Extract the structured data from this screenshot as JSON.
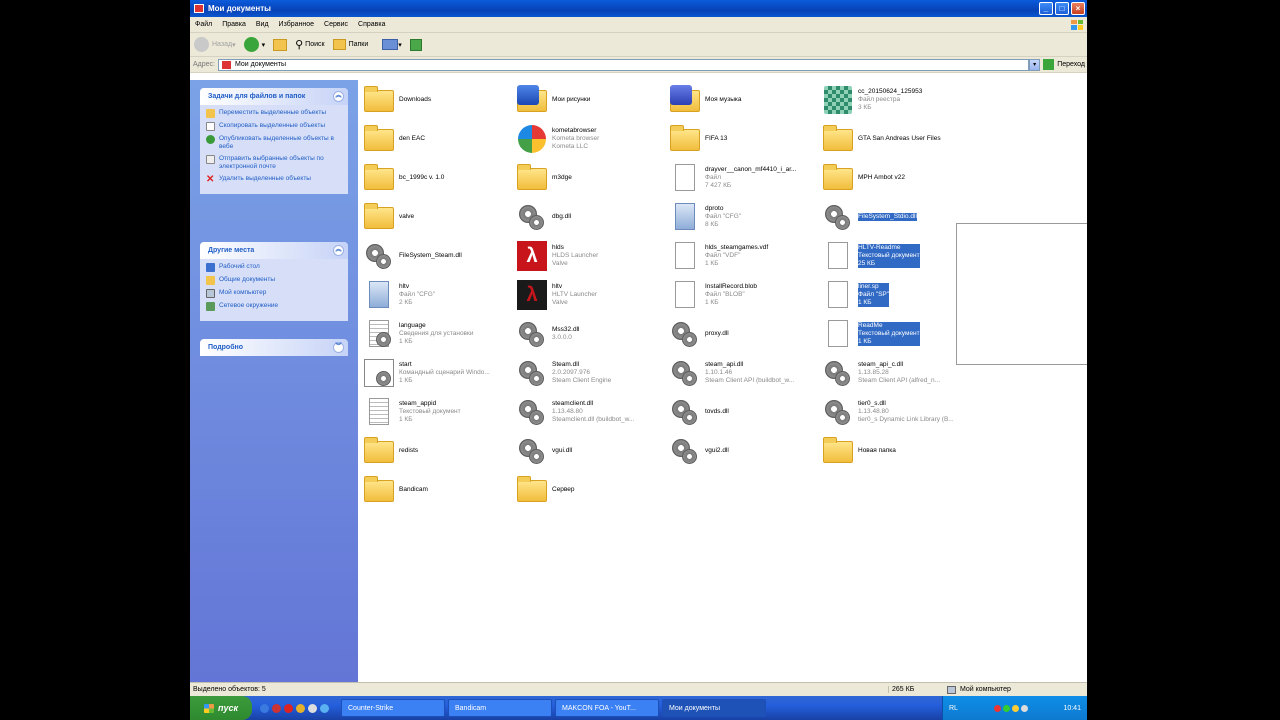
{
  "window": {
    "title": "Мои документы",
    "menu": [
      "Файл",
      "Правка",
      "Вид",
      "Избранное",
      "Сервис",
      "Справка"
    ],
    "toolbar": {
      "back": "Назад",
      "search": "Поиск",
      "folders": "Папки"
    },
    "address": {
      "label": "Адрес:",
      "value": "Мои документы",
      "go": "Переход"
    }
  },
  "sidebar": {
    "tasks": {
      "title": "Задачи для файлов и папок",
      "items": [
        "Переместить выделенные объекты",
        "Скопировать выделенные объекты",
        "Опубликовать выделенные объекты в вебе",
        "Отправить выбранные объекты по электронной почте",
        "Удалить выделенные объекты"
      ]
    },
    "places": {
      "title": "Другие места",
      "items": [
        "Рабочий стол",
        "Общие документы",
        "Мой компьютер",
        "Сетевое окружение"
      ]
    },
    "details": {
      "title": "Подробно"
    }
  },
  "files": [
    {
      "name": "Downloads",
      "icon": "folder",
      "col": 0,
      "row": 0
    },
    {
      "name": "Мои рисунки",
      "icon": "pictures",
      "col": 1,
      "row": 0
    },
    {
      "name": "Моя музыка",
      "icon": "music",
      "col": 2,
      "row": 0
    },
    {
      "name": "cc_20150624_125953",
      "desc": "Файл реестра",
      "desc2": "3 КБ",
      "icon": "registry",
      "col": 3,
      "row": 0
    },
    {
      "name": "den EAC",
      "icon": "folder",
      "col": 0,
      "row": 1
    },
    {
      "name": "kometabrowser",
      "desc": "Kometa browser",
      "desc2": "Kometa LLC",
      "icon": "kometa",
      "col": 1,
      "row": 1
    },
    {
      "name": "FIFA 13",
      "icon": "folder",
      "col": 2,
      "row": 1
    },
    {
      "name": "GTA San Andreas User Files",
      "icon": "folder",
      "col": 3,
      "row": 1
    },
    {
      "name": "bc_1999c v. 1.0",
      "icon": "folder",
      "col": 0,
      "row": 2
    },
    {
      "name": "m3dge",
      "icon": "folder",
      "col": 1,
      "row": 2
    },
    {
      "name": "drayver__canon_mf4410_i_ar...",
      "desc": "Файл",
      "desc2": "7 427 КБ",
      "icon": "doc",
      "col": 2,
      "row": 2
    },
    {
      "name": "MPH Ambot v22",
      "icon": "folder",
      "col": 3,
      "row": 2
    },
    {
      "name": "valve",
      "icon": "folder",
      "col": 0,
      "row": 3
    },
    {
      "name": "dbg.dll",
      "icon": "gear",
      "col": 1,
      "row": 3
    },
    {
      "name": "dproto",
      "desc": "Файл \"CFG\"",
      "desc2": "8 КБ",
      "icon": "cfg",
      "col": 2,
      "row": 3
    },
    {
      "name": "FileSystem_Stdio.dll",
      "icon": "gear",
      "col": 3,
      "row": 3,
      "selected": true
    },
    {
      "name": "FileSystem_Steam.dll",
      "icon": "gear",
      "col": 0,
      "row": 4
    },
    {
      "name": "hlds",
      "desc": "HLDS Launcher",
      "desc2": "Valve",
      "icon": "hlds",
      "col": 1,
      "row": 4
    },
    {
      "name": "hlds_steamgames.vdf",
      "desc": "Файл \"VDF\"",
      "desc2": "1 КБ",
      "icon": "doc",
      "col": 2,
      "row": 4
    },
    {
      "name": "HLTV-Readme",
      "desc": "Текстовый документ",
      "desc2": "25 КБ",
      "icon": "doc",
      "col": 3,
      "row": 4,
      "selected": true
    },
    {
      "name": "hltv",
      "desc": "Файл \"CFG\"",
      "desc2": "2 КБ",
      "icon": "cfg",
      "col": 0,
      "row": 5
    },
    {
      "name": "hltv",
      "desc": "HLTV Launcher",
      "desc2": "Valve",
      "icon": "hltv",
      "col": 1,
      "row": 5
    },
    {
      "name": "InstallRecord.blob",
      "desc": "Файл \"BLOB\"",
      "desc2": "1 КБ",
      "icon": "doc",
      "col": 2,
      "row": 5
    },
    {
      "name": "liner.sp",
      "desc": "Файл \"SP\"",
      "desc2": "1 КБ",
      "icon": "doc",
      "col": 3,
      "row": 5,
      "selected": true
    },
    {
      "name": "language",
      "desc": "Сведения для установки",
      "desc2": "1 КБ",
      "icon": "gearinfo",
      "col": 0,
      "row": 6
    },
    {
      "name": "Mss32.dll",
      "desc": "3.0.0.0",
      "icon": "gear",
      "col": 1,
      "row": 6
    },
    {
      "name": "proxy.dll",
      "icon": "gear",
      "col": 2,
      "row": 6
    },
    {
      "name": "ReadMe",
      "desc": "Текстовый документ",
      "desc2": "1 КБ",
      "icon": "doc",
      "col": 3,
      "row": 6,
      "selected": true
    },
    {
      "name": "start",
      "desc": "Командный сценарий Windo...",
      "desc2": "1 КБ",
      "icon": "cmd",
      "col": 0,
      "row": 7
    },
    {
      "name": "Steam.dll",
      "desc": "2.0.2097.976",
      "desc2": "Steam Client Engine",
      "icon": "gear",
      "col": 1,
      "row": 7
    },
    {
      "name": "steam_api.dll",
      "desc": "1.10.1.46",
      "desc2": "Steam Client API (buildbot_w...",
      "icon": "gear",
      "col": 2,
      "row": 7
    },
    {
      "name": "steam_api_c.dll",
      "desc": "1.13.85.28",
      "desc2": "Steam Client API (alfred_n...",
      "icon": "gear",
      "col": 3,
      "row": 7
    },
    {
      "name": "steam_appid",
      "desc": "Текстовый документ",
      "desc2": "1 КБ",
      "icon": "txt",
      "col": 0,
      "row": 8
    },
    {
      "name": "steamclient.dll",
      "desc": "1.13.48.80",
      "desc2": "Steamclient.dll (buildbot_w...",
      "icon": "gear",
      "col": 1,
      "row": 8
    },
    {
      "name": "tovds.dll",
      "icon": "gear",
      "col": 2,
      "row": 8
    },
    {
      "name": "tier0_s.dll",
      "desc": "1.13.48.80",
      "desc2": "tier0_s Dynamic Link Library (B...",
      "icon": "gear",
      "col": 3,
      "row": 8
    },
    {
      "name": "redists",
      "icon": "folder",
      "col": 0,
      "row": 9
    },
    {
      "name": "vgui.dll",
      "icon": "gear",
      "col": 1,
      "row": 9
    },
    {
      "name": "vgui2.dll",
      "icon": "gear",
      "col": 2,
      "row": 9
    },
    {
      "name": "Новая папка",
      "icon": "folder",
      "col": 3,
      "row": 9
    },
    {
      "name": "Bandicam",
      "icon": "folder",
      "col": 0,
      "row": 10
    },
    {
      "name": "Сервер",
      "icon": "folder",
      "col": 1,
      "row": 10
    }
  ],
  "status": {
    "selected": "Выделено объектов: 5",
    "size": "265 КБ",
    "location": "Мой компьютер"
  },
  "taskbar": {
    "start": "пуск",
    "tasks": [
      "Counter-Strike",
      "Bandicam",
      "MAKCON FOA - YouT...",
      "Мои документы"
    ],
    "lang": "RL",
    "clock": "10:41"
  },
  "colors": {
    "selection": "#316ac5",
    "taskpane": "#7ba2e7",
    "titlebar": "#0a5bdc"
  }
}
